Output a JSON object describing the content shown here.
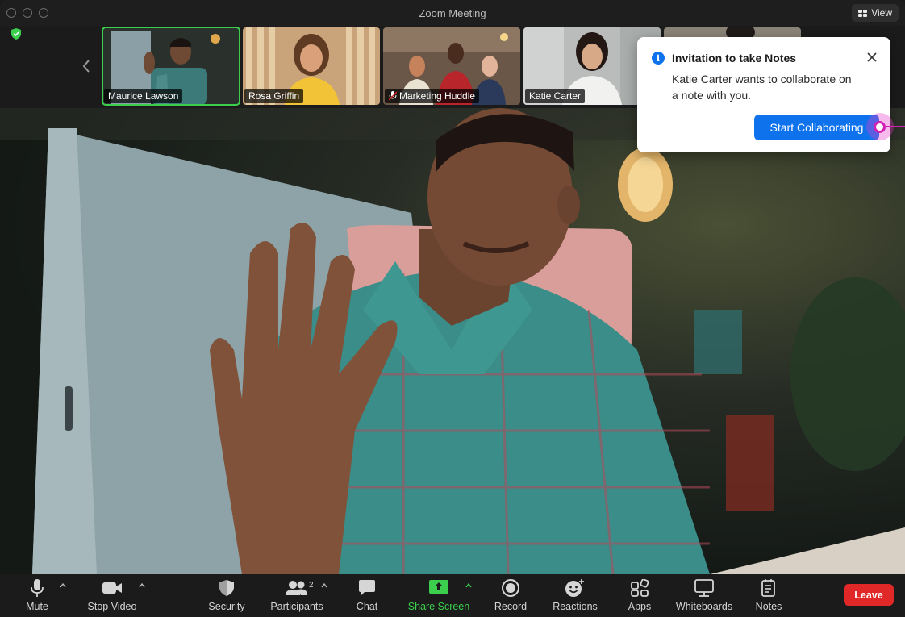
{
  "window": {
    "title": "Zoom Meeting",
    "view_label": "View"
  },
  "thumbnails": [
    {
      "name": "Maurice Lawson",
      "active": true
    },
    {
      "name": "Rosa Griffin",
      "active": false
    },
    {
      "name": "Marketing Huddle",
      "active": false,
      "muted": true
    },
    {
      "name": "Katie Carter",
      "active": false
    },
    {
      "name": "",
      "active": false
    }
  ],
  "notification": {
    "title": "Invitation to take Notes",
    "body": "Katie Carter wants to collaborate on a note with you.",
    "button_label": "Start Collaborating"
  },
  "toolbar": {
    "mute_label": "Mute",
    "stop_video_label": "Stop Video",
    "security_label": "Security",
    "participants_label": "Participants",
    "participants_count": "2",
    "chat_label": "Chat",
    "share_screen_label": "Share Screen",
    "record_label": "Record",
    "reactions_label": "Reactions",
    "apps_label": "Apps",
    "whiteboards_label": "Whiteboards",
    "notes_label": "Notes",
    "leave_label": "Leave"
  },
  "colors": {
    "accent_blue": "#0e72ed",
    "active_green": "#3ccf4e",
    "leave_red": "#e02828",
    "cursor_magenta": "#d21fb4"
  }
}
